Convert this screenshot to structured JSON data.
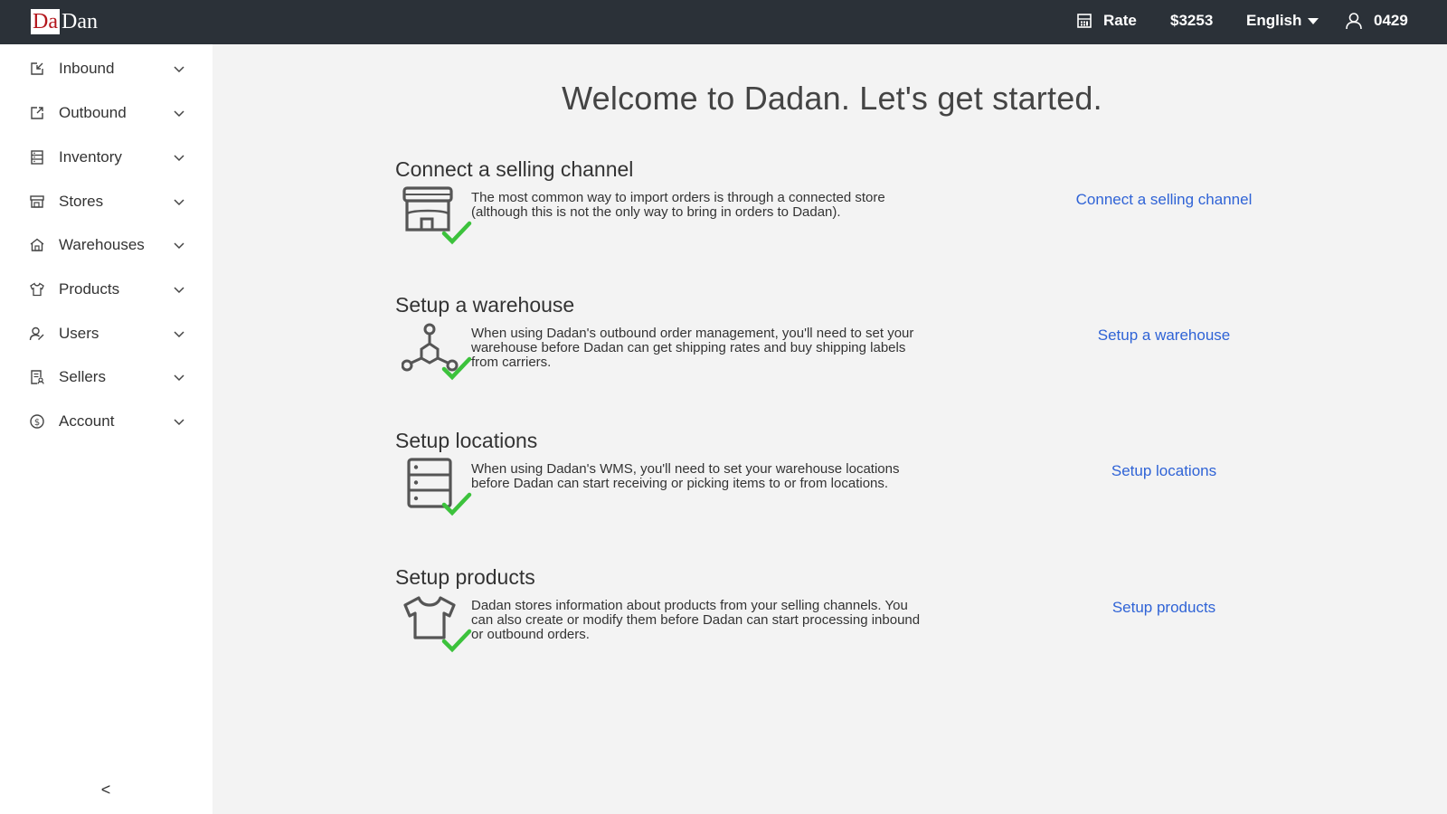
{
  "header": {
    "logo_part1": "Da",
    "logo_part2": "Dan",
    "rate_label": "Rate",
    "balance": "$3253",
    "language": "English",
    "user_id": "0429"
  },
  "sidebar": {
    "items": [
      {
        "label": "Inbound",
        "icon": "inbound-icon"
      },
      {
        "label": "Outbound",
        "icon": "outbound-icon"
      },
      {
        "label": "Inventory",
        "icon": "inventory-icon"
      },
      {
        "label": "Stores",
        "icon": "store-icon"
      },
      {
        "label": "Warehouses",
        "icon": "warehouse-icon"
      },
      {
        "label": "Products",
        "icon": "shirt-icon"
      },
      {
        "label": "Users",
        "icon": "users-icon"
      },
      {
        "label": "Sellers",
        "icon": "sellers-icon"
      },
      {
        "label": "Account",
        "icon": "dollar-icon"
      }
    ],
    "collapse_glyph": "<"
  },
  "main": {
    "title": "Welcome to Dadan. Let's get started.",
    "sections": [
      {
        "heading": "Connect a selling channel",
        "description": "The most common way to import orders is through a connected store (although this is not the only way to bring in orders to Dadan).",
        "link": "Connect a selling channel",
        "icon": "storefront-check-icon"
      },
      {
        "heading": "Setup a warehouse",
        "description": "When using Dadan's outbound order management, you'll need to set your warehouse before Dadan can get shipping rates and buy shipping labels from carriers.",
        "link": "Setup a warehouse",
        "icon": "network-check-icon"
      },
      {
        "heading": "Setup locations",
        "description": "When using Dadan's WMS, you'll need to set your warehouse locations before Dadan can start receiving or picking items to or from locations.",
        "link": "Setup locations",
        "icon": "shelves-check-icon"
      },
      {
        "heading": "Setup products",
        "description": "Dadan stores information about products from your selling channels. You can also create or modify them before Dadan can start processing inbound or outbound orders.",
        "link": "Setup products",
        "icon": "tshirt-check-icon"
      }
    ]
  },
  "colors": {
    "topbar": "#2b3138",
    "link": "#2f63d6",
    "check": "#3cc23c",
    "logo_red": "#b4161c"
  }
}
